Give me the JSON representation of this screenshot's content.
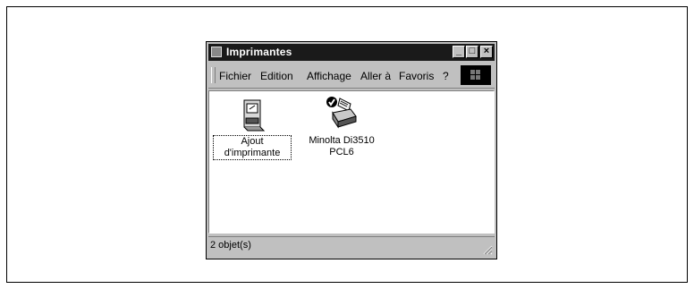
{
  "window": {
    "title": "Imprimantes"
  },
  "titlebar_buttons": {
    "minimize": "_",
    "maximize": "□",
    "close": "×"
  },
  "menu": {
    "items": [
      {
        "label": "Fichier"
      },
      {
        "label": "Edition"
      },
      {
        "label": "Affichage"
      },
      {
        "label": "Aller à"
      },
      {
        "label": "Favoris"
      },
      {
        "label": "?"
      }
    ]
  },
  "items": [
    {
      "label": "Ajout d'imprimante",
      "icon": "add-printer-icon"
    },
    {
      "label_line1": "Minolta Di3510",
      "label_line2": "PCL6",
      "icon": "printer-default-icon"
    }
  ],
  "status": {
    "text": "2 objet(s)"
  }
}
